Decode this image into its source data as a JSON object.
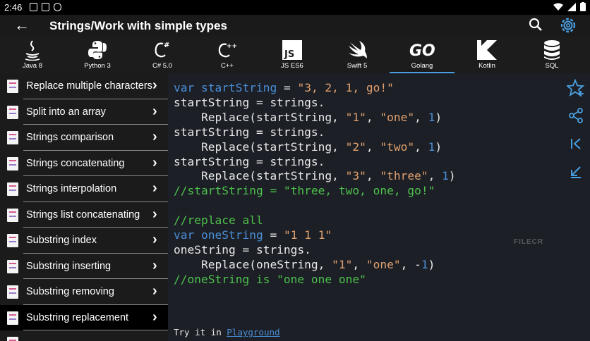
{
  "status": {
    "time": "2:46"
  },
  "appbar": {
    "title": "Strings/Work with simple types"
  },
  "languages": [
    {
      "name": "Java 8",
      "icon": "java-icon"
    },
    {
      "name": "Python 3",
      "icon": "python-icon"
    },
    {
      "name": "C# 5.0",
      "icon": "csharp-icon"
    },
    {
      "name": "C++",
      "icon": "cpp-icon"
    },
    {
      "name": "JS ES6",
      "icon": "js-icon"
    },
    {
      "name": "Swift 5",
      "icon": "swift-icon"
    },
    {
      "name": "Golang",
      "icon": "go-icon",
      "active": true
    },
    {
      "name": "Kotlin",
      "icon": "kotlin-icon"
    },
    {
      "name": "SQL",
      "icon": "database-icon"
    }
  ],
  "sidebar": {
    "items": [
      {
        "label": "Replace multiple characters"
      },
      {
        "label": "Split into an array"
      },
      {
        "label": "Strings comparison"
      },
      {
        "label": "Strings concatenating"
      },
      {
        "label": "Strings interpolation"
      },
      {
        "label": "Strings list concatenating"
      },
      {
        "label": "Substring index"
      },
      {
        "label": "Substring inserting"
      },
      {
        "label": "Substring removing"
      },
      {
        "label": "Substring replacement",
        "selected": true
      }
    ]
  },
  "code": {
    "l1": {
      "kw": "var",
      "id": "startString",
      "op": " = ",
      "str": "\"3, 2, 1, go!\""
    },
    "l2": "startString = strings.",
    "l3": {
      "a": "Replace(startString, ",
      "s1": "\"1\"",
      "c": ", ",
      "s2": "\"one\"",
      "d": ", ",
      "n": "1",
      "e": ")"
    },
    "l4": "startString = strings.",
    "l5": {
      "a": "Replace(startString, ",
      "s1": "\"2\"",
      "c": ", ",
      "s2": "\"two\"",
      "d": ", ",
      "n": "1",
      "e": ")"
    },
    "l6": "startString = strings.",
    "l7": {
      "a": "Replace(startString, ",
      "s1": "\"3\"",
      "c": ", ",
      "s2": "\"three\"",
      "d": ", ",
      "n": "1",
      "e": ")"
    },
    "l8": "//startString = \"three, two, one, go!\"",
    "l10": "//replace all",
    "l11": {
      "kw": "var",
      "id": "oneString",
      "op": " = ",
      "str": "\"1 1 1\""
    },
    "l12": "oneString = strings.",
    "l13": {
      "a": "Replace(oneString, ",
      "s1": "\"1\"",
      "c": ", ",
      "s2": "\"one\"",
      "d": ", -",
      "n": "1",
      "e": ")"
    },
    "l14": "//oneString is \"one one one\""
  },
  "footer": {
    "try_text": "Try it in ",
    "link_text": "Playground"
  },
  "watermark": "FILECR",
  "colors": {
    "accent": "#4a9fe0",
    "keyword": "#4a8fd8",
    "string": "#e0a070",
    "comment": "#4ec04e"
  }
}
